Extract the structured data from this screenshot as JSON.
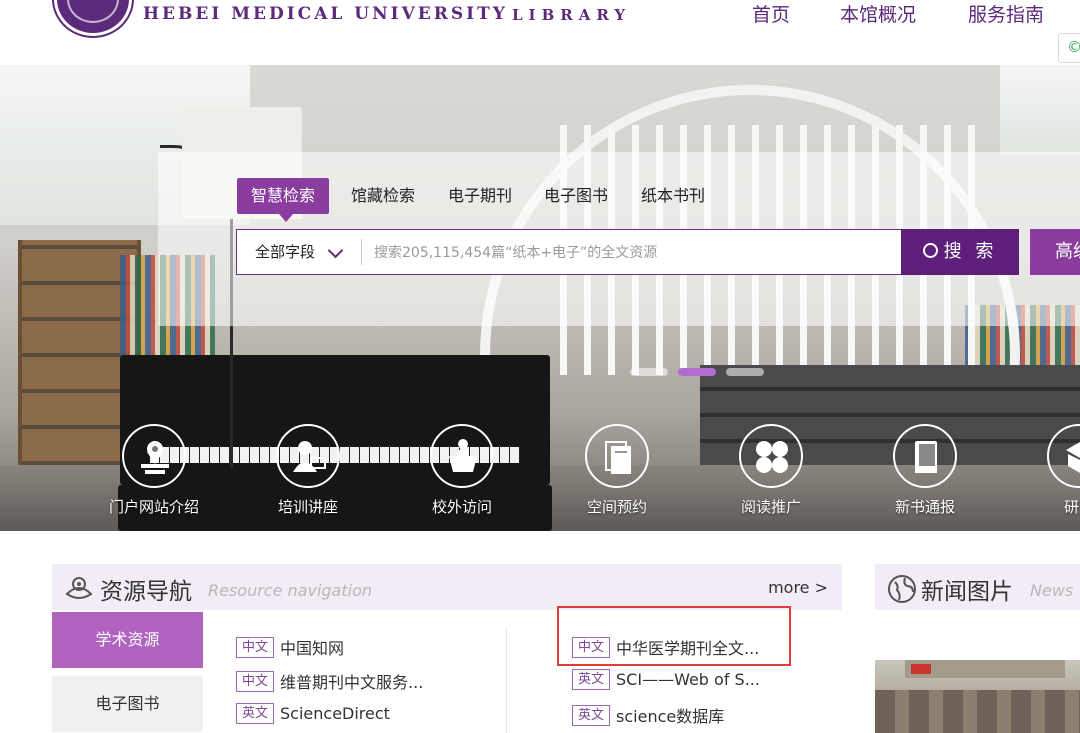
{
  "header": {
    "university_en": "HEBEI MEDICAL UNIVERSITY",
    "library_en": "LIBRARY",
    "nav": [
      "首页",
      "本馆概况",
      "服务指南"
    ],
    "badge_glyph": "©"
  },
  "search": {
    "tabs": [
      "智慧检索",
      "馆藏检索",
      "电子期刊",
      "电子图书",
      "纸本书刊"
    ],
    "active_tab": "智慧检索",
    "field_select": "全部字段",
    "placeholder": "搜索205,115,454篇“纸本+电子”的全文资源",
    "button_label": "搜 索",
    "advanced_label": "高级"
  },
  "carousel": {
    "slide_count": 3,
    "active_slide": 2
  },
  "quick_links": [
    {
      "label": "门户网站介绍",
      "icon": "map-pin-icon"
    },
    {
      "label": "培训讲座",
      "icon": "lecturer-icon"
    },
    {
      "label": "校外访问",
      "icon": "remote-access-icon"
    },
    {
      "label": "空间预约",
      "icon": "room-booking-icon"
    },
    {
      "label": "阅读推广",
      "icon": "reading-promotion-icon"
    },
    {
      "label": "新书通报",
      "icon": "new-books-icon"
    },
    {
      "label": "研究",
      "icon": "research-icon"
    }
  ],
  "resource_nav": {
    "title": "资源导航",
    "subtitle": "Resource navigation",
    "more": "more >",
    "side_tabs": [
      "学术资源",
      "电子图书"
    ],
    "items": [
      {
        "tag": "中文",
        "name": "中国知网"
      },
      {
        "tag": "中文",
        "name": "中华医学期刊全文..."
      },
      {
        "tag": "中文",
        "name": "维普期刊中文服务..."
      },
      {
        "tag": "英文",
        "name": "SCI——Web of S..."
      },
      {
        "tag": "英文",
        "name": "ScienceDirect"
      },
      {
        "tag": "英文",
        "name": "science数据库"
      }
    ]
  },
  "news": {
    "title": "新闻图片",
    "subtitle": "News"
  },
  "colors": {
    "brand_purple": "#5b2a7a",
    "accent_purple": "#8a3d9e",
    "search_button": "#5d1f7a",
    "side_tab_active": "#b064c0",
    "highlight_red": "#e23b3b"
  }
}
